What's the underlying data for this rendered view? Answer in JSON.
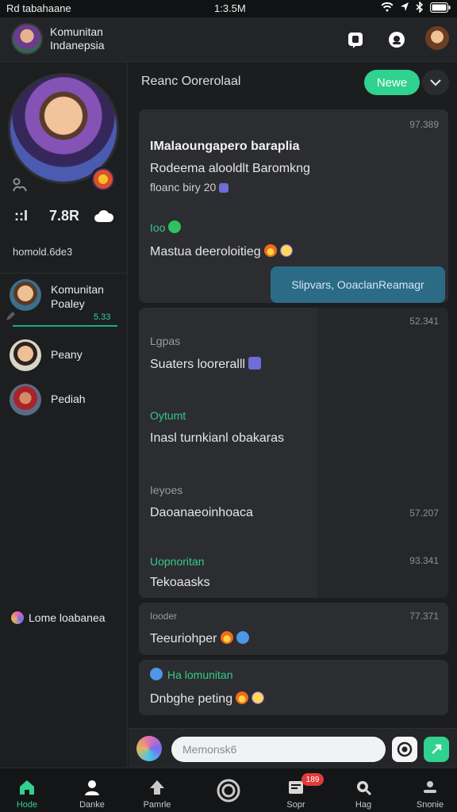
{
  "status": {
    "left": "Rd tabahaane",
    "time": "1:3.5M"
  },
  "header": {
    "title": "Komunitan Indanepsia"
  },
  "sidebar": {
    "stat_a": "::I",
    "stat_b": "7.8R",
    "sub_label": "homold.6de3",
    "contacts": [
      {
        "name": "Komunitan Poaley",
        "count": "5.33"
      },
      {
        "name": "Peany"
      },
      {
        "name": "Pediah"
      }
    ],
    "bottom_label": "Lome loabanea"
  },
  "main": {
    "title": "Reanc Oorerolaal",
    "new_label": "Newe",
    "card1": {
      "time": "97.389",
      "title": "IMalaoungapero baraplia",
      "line1": "Rodeema alooldlt Baromkng",
      "line2": "floanc biry 20",
      "tag": "Ioo",
      "message": "Mastua deeroloitieg",
      "bubble": "Slipvars, OoaclanReamagr"
    },
    "card2": {
      "time": "52.341",
      "lbl1": "Lgpas",
      "text1": "Suaters looreralll",
      "lbl2": "Oytumt",
      "text2": "Inasl turnkianl obakaras",
      "lbl3": "Ieyoes",
      "text3": "Daoanaeoinhoaca",
      "time2": "57.207",
      "lbl4": "Uopnoritan",
      "time3": "93.341",
      "text4": "Tekoaasks"
    },
    "card3": {
      "label": "Iooder",
      "time": "77.371",
      "text": "Teeuriohper"
    },
    "card4": {
      "label": "Ha lomunitan",
      "text": "Dnbghe peting"
    }
  },
  "composer": {
    "placeholder": "Memonsk6"
  },
  "nav": {
    "items": [
      {
        "label": "Hode"
      },
      {
        "label": "Danke"
      },
      {
        "label": "Pamrle"
      },
      {
        "label": ""
      },
      {
        "label": "Sopr"
      },
      {
        "label": "Hag"
      },
      {
        "label": "Snonie"
      }
    ],
    "badge": "189"
  }
}
